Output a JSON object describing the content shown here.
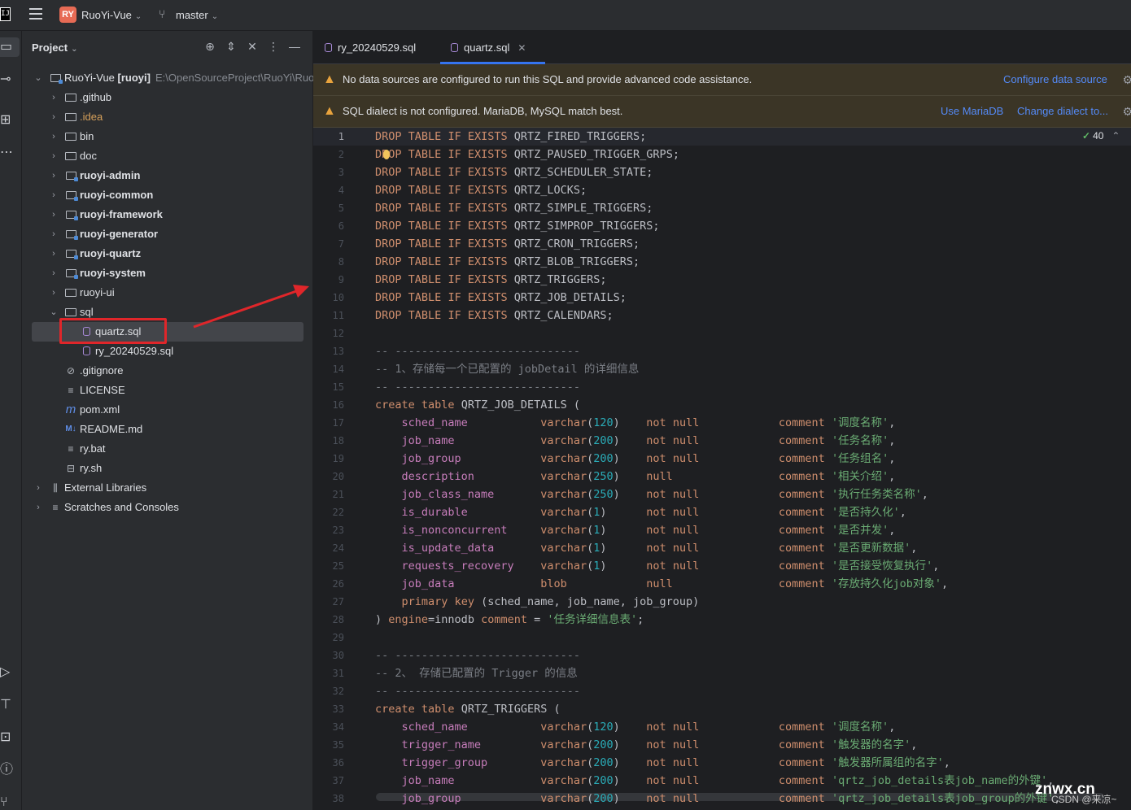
{
  "titlebar": {
    "app_icon": "IJ",
    "project_badge": "RY",
    "project_name": "RuoYi-Vue",
    "branch": "master"
  },
  "project_panel": {
    "title": "Project",
    "root": {
      "name": "RuoYi-Vue",
      "module": "[ruoyi]",
      "path": "E:\\OpenSourceProject\\RuoYi\\Ruo"
    },
    "items": [
      {
        "label": ".github"
      },
      {
        "label": ".idea"
      },
      {
        "label": "bin"
      },
      {
        "label": "doc"
      },
      {
        "label": "ruoyi-admin"
      },
      {
        "label": "ruoyi-common"
      },
      {
        "label": "ruoyi-framework"
      },
      {
        "label": "ruoyi-generator"
      },
      {
        "label": "ruoyi-quartz"
      },
      {
        "label": "ruoyi-system"
      },
      {
        "label": "ruoyi-ui"
      },
      {
        "label": "sql"
      },
      {
        "label": "quartz.sql"
      },
      {
        "label": "ry_20240529.sql"
      },
      {
        "label": ".gitignore"
      },
      {
        "label": "LICENSE"
      },
      {
        "label": "pom.xml"
      },
      {
        "label": "README.md"
      },
      {
        "label": "ry.bat"
      },
      {
        "label": "ry.sh"
      },
      {
        "label": "External Libraries"
      },
      {
        "label": "Scratches and Consoles"
      }
    ]
  },
  "tabs": [
    {
      "label": "ry_20240529.sql"
    },
    {
      "label": "quartz.sql",
      "active": true
    }
  ],
  "banners": {
    "datasource": {
      "message": "No data sources are configured to run this SQL and provide advanced code assistance.",
      "link": "Configure data source"
    },
    "dialect": {
      "message": "SQL dialect is not configured. MariaDB, MySQL match best.",
      "link1": "Use MariaDB",
      "link2": "Change dialect to..."
    }
  },
  "inspection": {
    "count": "40"
  },
  "code_lines": [
    {
      "n": "1",
      "t": "DROP TABLE IF EXISTS QRTZ_FIRED_TRIGGERS;"
    },
    {
      "n": "2",
      "t": "DROP TABLE IF EXISTS QRTZ_PAUSED_TRIGGER_GRPS;"
    },
    {
      "n": "3",
      "t": "DROP TABLE IF EXISTS QRTZ_SCHEDULER_STATE;"
    },
    {
      "n": "4",
      "t": "DROP TABLE IF EXISTS QRTZ_LOCKS;"
    },
    {
      "n": "5",
      "t": "DROP TABLE IF EXISTS QRTZ_SIMPLE_TRIGGERS;"
    },
    {
      "n": "6",
      "t": "DROP TABLE IF EXISTS QRTZ_SIMPROP_TRIGGERS;"
    },
    {
      "n": "7",
      "t": "DROP TABLE IF EXISTS QRTZ_CRON_TRIGGERS;"
    },
    {
      "n": "8",
      "t": "DROP TABLE IF EXISTS QRTZ_BLOB_TRIGGERS;"
    },
    {
      "n": "9",
      "t": "DROP TABLE IF EXISTS QRTZ_TRIGGERS;"
    },
    {
      "n": "10",
      "t": "DROP TABLE IF EXISTS QRTZ_JOB_DETAILS;"
    },
    {
      "n": "11",
      "t": "DROP TABLE IF EXISTS QRTZ_CALENDARS;"
    },
    {
      "n": "12",
      "t": ""
    },
    {
      "n": "13",
      "t": "-- ----------------------------"
    },
    {
      "n": "14",
      "t": "-- 1、存储每一个已配置的 jobDetail 的详细信息"
    },
    {
      "n": "15",
      "t": "-- ----------------------------"
    },
    {
      "n": "16",
      "t": "create table QRTZ_JOB_DETAILS ("
    },
    {
      "n": "17",
      "t": "    sched_name           varchar(120)    not null            comment '调度名称',"
    },
    {
      "n": "18",
      "t": "    job_name             varchar(200)    not null            comment '任务名称',"
    },
    {
      "n": "19",
      "t": "    job_group            varchar(200)    not null            comment '任务组名',"
    },
    {
      "n": "20",
      "t": "    description          varchar(250)    null                comment '相关介绍',"
    },
    {
      "n": "21",
      "t": "    job_class_name       varchar(250)    not null            comment '执行任务类名称',"
    },
    {
      "n": "22",
      "t": "    is_durable           varchar(1)      not null            comment '是否持久化',"
    },
    {
      "n": "23",
      "t": "    is_nonconcurrent     varchar(1)      not null            comment '是否并发',"
    },
    {
      "n": "24",
      "t": "    is_update_data       varchar(1)      not null            comment '是否更新数据',"
    },
    {
      "n": "25",
      "t": "    requests_recovery    varchar(1)      not null            comment '是否接受恢复执行',"
    },
    {
      "n": "26",
      "t": "    job_data             blob            null                comment '存放持久化job对象',"
    },
    {
      "n": "27",
      "t": "    primary key (sched_name, job_name, job_group)"
    },
    {
      "n": "28",
      "t": ") engine=innodb comment = '任务详细信息表';"
    },
    {
      "n": "29",
      "t": ""
    },
    {
      "n": "30",
      "t": "-- ----------------------------"
    },
    {
      "n": "31",
      "t": "-- 2、 存储已配置的 Trigger 的信息"
    },
    {
      "n": "32",
      "t": "-- ----------------------------"
    },
    {
      "n": "33",
      "t": "create table QRTZ_TRIGGERS ("
    },
    {
      "n": "34",
      "t": "    sched_name           varchar(120)    not null            comment '调度名称',"
    },
    {
      "n": "35",
      "t": "    trigger_name         varchar(200)    not null            comment '触发器的名字',"
    },
    {
      "n": "36",
      "t": "    trigger_group        varchar(200)    not null            comment '触发器所属组的名字',"
    },
    {
      "n": "37",
      "t": "    job_name             varchar(200)    not null            comment 'qrtz_job_details表job_name的外键',"
    },
    {
      "n": "38",
      "t": "    job_group            varchar(200)    not null            comment 'qrtz_job_details表job_group的外键',"
    }
  ],
  "watermark": {
    "site": "znwx.cn",
    "credit": "CSDN @来凉~"
  },
  "colors": {
    "accent": "#3574f0",
    "annotation_red": "#e0262a",
    "keyword": "#cf8e6d",
    "string": "#6aab73",
    "field": "#c77dbb"
  }
}
